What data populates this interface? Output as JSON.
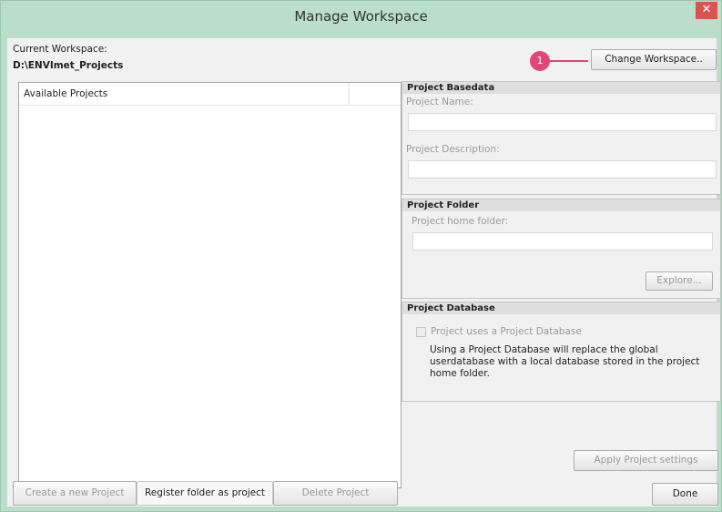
{
  "window": {
    "title": "Manage Workspace",
    "close_glyph": "✕"
  },
  "workspace": {
    "label": "Current Workspace:",
    "path": "D:\\ENVImet_Projects",
    "change_button": "Change Workspace..",
    "marker_number": "1"
  },
  "project_list": {
    "column_header": "Available Projects"
  },
  "basedata": {
    "header": "Project Basedata",
    "name_label": "Project Name:",
    "name_value": "",
    "description_label": "Project Description:",
    "description_value": ""
  },
  "folder": {
    "header": "Project Folder",
    "home_label": "Project home folder:",
    "home_value": "",
    "explore_button": "Explore..."
  },
  "database": {
    "header": "Project Database",
    "checkbox_label": "Project uses a Project Database",
    "checkbox_checked": false,
    "info_text": "Using a Project Database will replace the global userdatabase with a local database stored in the project home folder."
  },
  "actions": {
    "apply_button": "Apply Project settings",
    "create_button": "Create a new Project",
    "register_button": "Register folder as project",
    "delete_button": "Delete Project",
    "done_button": "Done"
  },
  "colors": {
    "accent_marker": "#e0457b",
    "close_button": "#d9534f",
    "window_frame": "#b9dfca"
  }
}
